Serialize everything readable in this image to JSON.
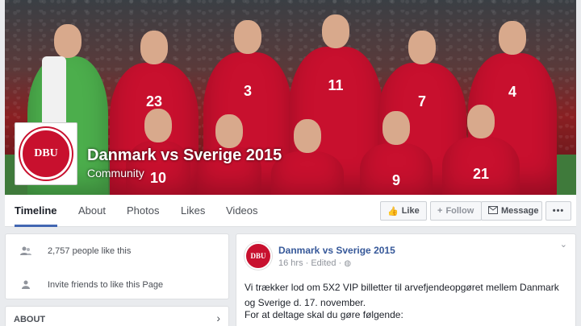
{
  "page": {
    "name": "Danmark vs Sverige 2015",
    "category": "Community",
    "logo_text": "DBU"
  },
  "cover": {
    "jersey_numbers": [
      "23",
      "3",
      "11",
      "7",
      "4",
      "10",
      "9",
      "21"
    ]
  },
  "nav": {
    "tabs": [
      "Timeline",
      "About",
      "Photos",
      "Likes",
      "Videos"
    ],
    "like_label": "Like",
    "follow_label": "Follow",
    "message_label": "Message",
    "more_label": "•••"
  },
  "sidebar": {
    "likes_text": "2,757 people like this",
    "invite_text": "Invite friends to like this Page",
    "about_label": "ABOUT"
  },
  "post": {
    "author": "Danmark vs Sverige 2015",
    "meta": "16 hrs · Edited · ",
    "text": "Vi trækker lod om 5X2 VIP billetter til arvefjendeopgøret mellem Danmark og Sverige d. 17. november.",
    "text2": "For at deltage skal du gøre følgende:"
  },
  "colors": {
    "accent": "#4267b2",
    "link": "#365899",
    "jersey_red": "#c8102e"
  }
}
